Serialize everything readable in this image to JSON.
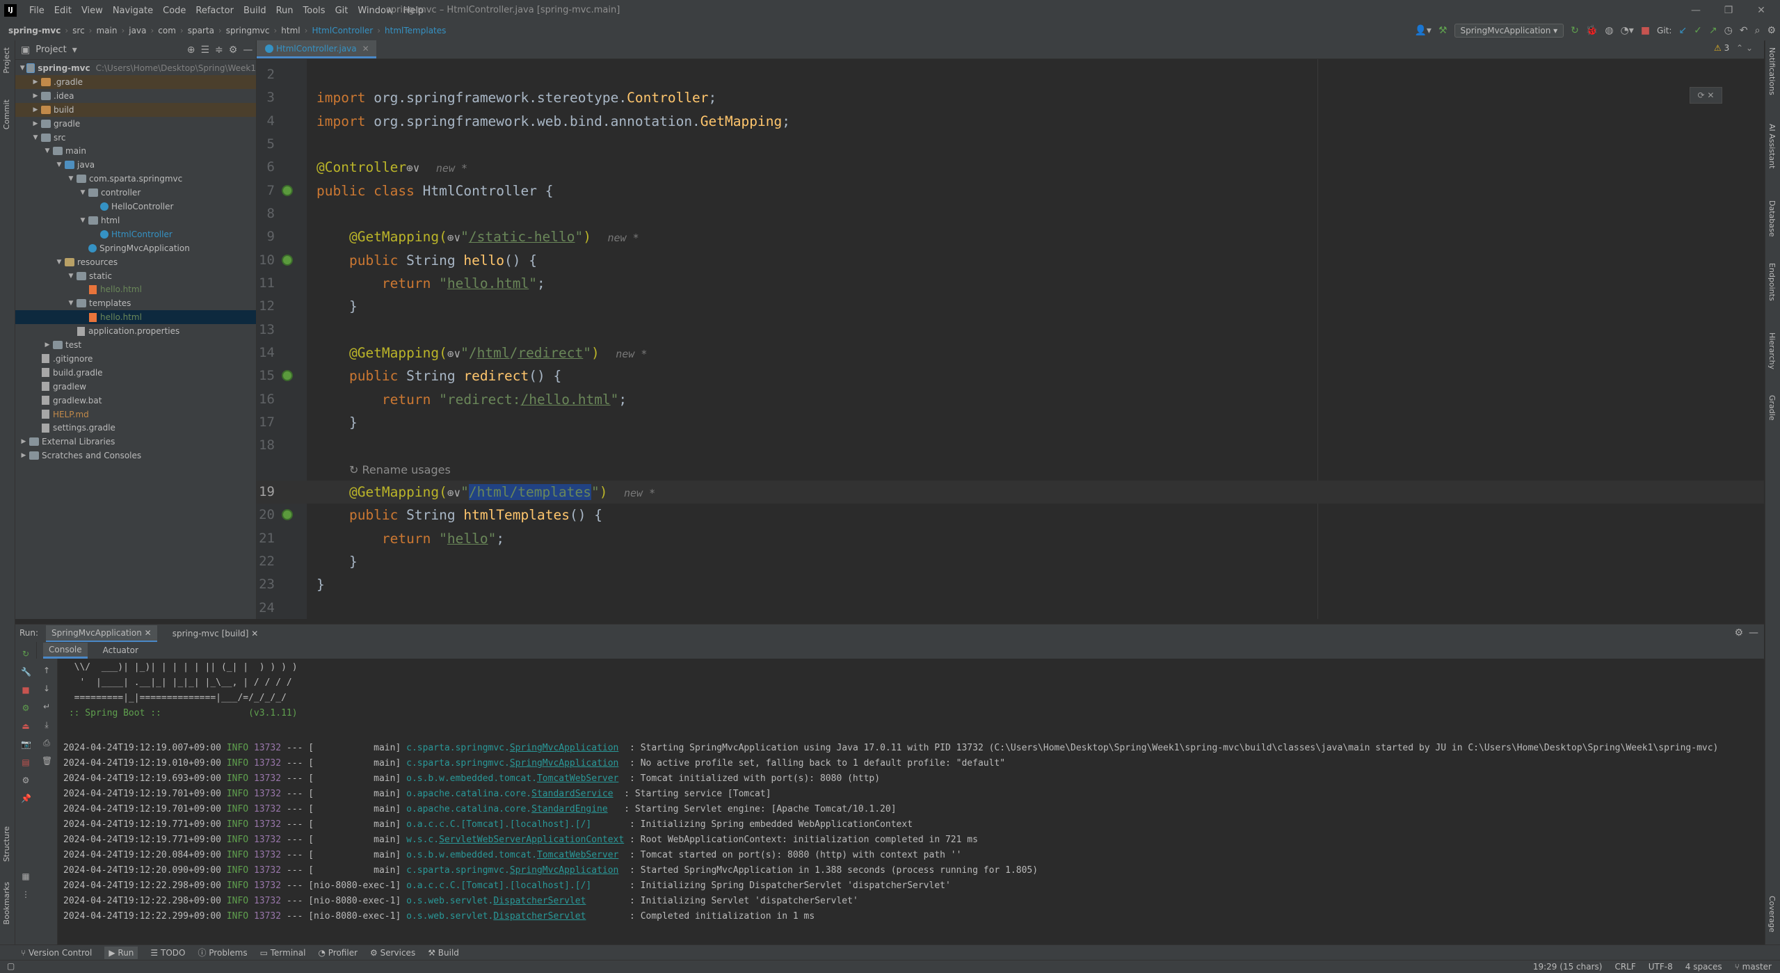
{
  "titlebar": {
    "logo": "IJ",
    "menu": [
      "File",
      "Edit",
      "View",
      "Navigate",
      "Code",
      "Refactor",
      "Build",
      "Run",
      "Tools",
      "Git",
      "Window",
      "Help"
    ],
    "title": "spring-mvc – HtmlController.java [spring-mvc.main]"
  },
  "breadcrumbs": [
    "spring-mvc",
    "src",
    "main",
    "java",
    "com",
    "sparta",
    "springmvc",
    "html",
    "HtmlController",
    "htmlTemplates"
  ],
  "toolbar": {
    "run_config": "SpringMvcApplication",
    "git_label": "Git:"
  },
  "left_stripe": {
    "project": "Project",
    "commit": "Commit",
    "structure": "Structure",
    "bookmarks": "Bookmarks"
  },
  "right_stripe": [
    "Notifications",
    "AI Assistant",
    "Database",
    "Endpoints",
    "Hierarchy",
    "Gradle",
    "Coverage"
  ],
  "project_panel": {
    "title": "Project",
    "tree": [
      {
        "label": "spring-mvc",
        "path": "C:\\Users\\Home\\Desktop\\Spring\\Week1",
        "depth": 0,
        "icon": "module-folder",
        "open": true
      },
      {
        "label": ".gradle",
        "depth": 1,
        "icon": "orange-folder",
        "open": false,
        "hl": true
      },
      {
        "label": ".idea",
        "depth": 1,
        "icon": "folder",
        "open": false
      },
      {
        "label": "build",
        "depth": 1,
        "icon": "orange-folder",
        "open": false,
        "hl": true
      },
      {
        "label": "gradle",
        "depth": 1,
        "icon": "folder",
        "open": false
      },
      {
        "label": "src",
        "depth": 1,
        "icon": "folder",
        "open": true
      },
      {
        "label": "main",
        "depth": 2,
        "icon": "folder",
        "open": true
      },
      {
        "label": "java",
        "depth": 3,
        "icon": "src-folder",
        "open": true
      },
      {
        "label": "com.sparta.springmvc",
        "depth": 4,
        "icon": "folder",
        "open": true
      },
      {
        "label": "controller",
        "depth": 5,
        "icon": "folder",
        "open": true
      },
      {
        "label": "HelloController",
        "depth": 6,
        "icon": "class"
      },
      {
        "label": "html",
        "depth": 5,
        "icon": "folder",
        "open": true
      },
      {
        "label": "HtmlController",
        "depth": 6,
        "icon": "class",
        "color": "#3592c4"
      },
      {
        "label": "SpringMvcApplication",
        "depth": 5,
        "icon": "class"
      },
      {
        "label": "resources",
        "depth": 3,
        "icon": "res-folder",
        "open": true
      },
      {
        "label": "static",
        "depth": 4,
        "icon": "folder",
        "open": true
      },
      {
        "label": "hello.html",
        "depth": 5,
        "icon": "html-file",
        "color": "#6a8759"
      },
      {
        "label": "templates",
        "depth": 4,
        "icon": "folder",
        "open": true
      },
      {
        "label": "hello.html",
        "depth": 5,
        "icon": "html-file",
        "color": "#6a8759",
        "selected": true
      },
      {
        "label": "application.properties",
        "depth": 4,
        "icon": "file"
      },
      {
        "label": "test",
        "depth": 2,
        "icon": "folder",
        "open": false
      },
      {
        "label": ".gitignore",
        "depth": 1,
        "icon": "file"
      },
      {
        "label": "build.gradle",
        "depth": 1,
        "icon": "file"
      },
      {
        "label": "gradlew",
        "depth": 1,
        "icon": "file"
      },
      {
        "label": "gradlew.bat",
        "depth": 1,
        "icon": "file"
      },
      {
        "label": "HELP.md",
        "depth": 1,
        "icon": "file",
        "color": "#c28a4a"
      },
      {
        "label": "settings.gradle",
        "depth": 1,
        "icon": "file"
      },
      {
        "label": "External Libraries",
        "depth": 0,
        "icon": "folder",
        "open": false
      },
      {
        "label": "Scratches and Consoles",
        "depth": 0,
        "icon": "folder",
        "open": false
      }
    ]
  },
  "editor": {
    "tab": "HtmlController.java",
    "warnings": "3",
    "lines": [
      {
        "n": "2",
        "html": ""
      },
      {
        "n": "3",
        "html": "<span class='kw'>import</span> org.springframework.stereotype.<span class='fn'>Controller</span>;"
      },
      {
        "n": "4",
        "html": "<span class='kw'>import</span> org.springframework.web.bind.annotation.<span class='fn'>GetMapping</span>;"
      },
      {
        "n": "5",
        "html": ""
      },
      {
        "n": "6",
        "html": "<span class='ann'>@Controller</span><span class='globe'>⊕∨</span>  <span class='hint'>new *</span>"
      },
      {
        "n": "7",
        "html": "<span class='kw'>public class</span> HtmlController {",
        "bean": true
      },
      {
        "n": "8",
        "html": ""
      },
      {
        "n": "9",
        "html": "    <span class='ann'>@GetMapping(</span><span class='globe'>⊕∨</span><span class='str'>\"</span><span class='strul'>/static-hello</span><span class='str'>\"</span><span class='ann'>)</span>  <span class='hint'>new *</span>"
      },
      {
        "n": "10",
        "html": "    <span class='kw'>public</span> String <span class='fn'>hello</span>() {",
        "bean": true
      },
      {
        "n": "11",
        "html": "        <span class='kw'>return</span> <span class='str'>\"</span><span class='strul'>hello.html</span><span class='str'>\"</span>;"
      },
      {
        "n": "12",
        "html": "    }"
      },
      {
        "n": "13",
        "html": ""
      },
      {
        "n": "14",
        "html": "    <span class='ann'>@GetMapping(</span><span class='globe'>⊕∨</span><span class='str'>\"/</span><span class='strul'>html</span><span class='str'>/</span><span class='strul'>redirect</span><span class='str'>\"</span><span class='ann'>)</span>  <span class='hint'>new *</span>"
      },
      {
        "n": "15",
        "html": "    <span class='kw'>public</span> String <span class='fn'>redirect</span>() {",
        "bean": true
      },
      {
        "n": "16",
        "html": "        <span class='kw'>return</span> <span class='str'>\"redirect:</span><span class='strul'>/hello.html</span><span class='str'>\"</span>;"
      },
      {
        "n": "17",
        "html": "    }"
      },
      {
        "n": "18",
        "html": ""
      },
      {
        "n": "",
        "html": "    <span style='color:#8c8c8c;font-size:16px;font-family:DejaVu Sans,sans-serif'>↻ Rename usages</span>"
      },
      {
        "n": "19",
        "html": "    <span class='ann'>@GetMapping(</span><span class='globe'>⊕∨</span><span class='str'>\"</span><span class='sel-text'>/html/templates</span><span class='str'>\"</span><span class='ann'>)</span>  <span class='hint'>new *</span>",
        "cur": true
      },
      {
        "n": "20",
        "html": "    <span class='kw'>public</span> String <span class='fn'>htmlTemplates</span>() {",
        "bean": true
      },
      {
        "n": "21",
        "html": "        <span class='kw'>return</span> <span class='str'>\"</span><span class='strul'>hello</span><span class='str'>\"</span>;"
      },
      {
        "n": "22",
        "html": "    }"
      },
      {
        "n": "23",
        "html": "}"
      },
      {
        "n": "24",
        "html": ""
      }
    ]
  },
  "run_panel": {
    "label": "Run:",
    "tabs": [
      "SpringMvcApplication",
      "spring-mvc [build]"
    ],
    "subtabs": [
      "Console",
      "Actuator"
    ],
    "banner": [
      "  \\\\/  ___)| |_)| | | | | || (_| |  ) ) ) )",
      "   '  |____| .__|_| |_|_| |_\\__, | / / / /",
      "  =========|_|==============|___/=/_/_/_/",
      " :: Spring Boot ::                (v3.1.11)"
    ],
    "logs": [
      {
        "ts": "2024-04-24T19:12:19.007+09:00",
        "level": "INFO",
        "pid": "13732",
        "thread": "[           main]",
        "logger_pre": "c.sparta.springmvc.",
        "logger_ul": "SpringMvcApplication",
        "logger_post": "  ",
        "msg": ": Starting SpringMvcApplication using Java 17.0.11 with PID 13732 (C:\\Users\\Home\\Desktop\\Spring\\Week1\\spring-mvc\\build\\classes\\java\\main started by JU in C:\\Users\\Home\\Desktop\\Spring\\Week1\\spring-mvc)"
      },
      {
        "ts": "2024-04-24T19:12:19.010+09:00",
        "level": "INFO",
        "pid": "13732",
        "thread": "[           main]",
        "logger_pre": "c.sparta.springmvc.",
        "logger_ul": "SpringMvcApplication",
        "logger_post": "  ",
        "msg": ": No active profile set, falling back to 1 default profile: \"default\""
      },
      {
        "ts": "2024-04-24T19:12:19.693+09:00",
        "level": "INFO",
        "pid": "13732",
        "thread": "[           main]",
        "logger_pre": "o.s.b.w.embedded.tomcat.",
        "logger_ul": "TomcatWebServer",
        "logger_post": "  ",
        "msg": ": Tomcat initialized with port(s): 8080 (http)"
      },
      {
        "ts": "2024-04-24T19:12:19.701+09:00",
        "level": "INFO",
        "pid": "13732",
        "thread": "[           main]",
        "logger_pre": "o.apache.catalina.core.",
        "logger_ul": "StandardService",
        "logger_post": "  ",
        "msg": ": Starting service [Tomcat]"
      },
      {
        "ts": "2024-04-24T19:12:19.701+09:00",
        "level": "INFO",
        "pid": "13732",
        "thread": "[           main]",
        "logger_pre": "o.apache.catalina.core.",
        "logger_ul": "StandardEngine",
        "logger_post": "   ",
        "msg": ": Starting Servlet engine: [Apache Tomcat/10.1.20]"
      },
      {
        "ts": "2024-04-24T19:12:19.771+09:00",
        "level": "INFO",
        "pid": "13732",
        "thread": "[           main]",
        "logger_pre": "o.a.c.c.C.[Tomcat].[localhost].[/]",
        "logger_ul": "",
        "logger_post": "       ",
        "msg": ": Initializing Spring embedded WebApplicationContext"
      },
      {
        "ts": "2024-04-24T19:12:19.771+09:00",
        "level": "INFO",
        "pid": "13732",
        "thread": "[           main]",
        "logger_pre": "w.s.c.",
        "logger_ul": "ServletWebServerApplicationContext",
        "logger_post": " ",
        "msg": ": Root WebApplicationContext: initialization completed in 721 ms"
      },
      {
        "ts": "2024-04-24T19:12:20.084+09:00",
        "level": "INFO",
        "pid": "13732",
        "thread": "[           main]",
        "logger_pre": "o.s.b.w.embedded.tomcat.",
        "logger_ul": "TomcatWebServer",
        "logger_post": "  ",
        "msg": ": Tomcat started on port(s): 8080 (http) with context path ''"
      },
      {
        "ts": "2024-04-24T19:12:20.090+09:00",
        "level": "INFO",
        "pid": "13732",
        "thread": "[           main]",
        "logger_pre": "c.sparta.springmvc.",
        "logger_ul": "SpringMvcApplication",
        "logger_post": "  ",
        "msg": ": Started SpringMvcApplication in 1.388 seconds (process running for 1.805)"
      },
      {
        "ts": "2024-04-24T19:12:22.298+09:00",
        "level": "INFO",
        "pid": "13732",
        "thread": "[nio-8080-exec-1]",
        "logger_pre": "o.a.c.c.C.[Tomcat].[localhost].[/]",
        "logger_ul": "",
        "logger_post": "       ",
        "msg": ": Initializing Spring DispatcherServlet 'dispatcherServlet'"
      },
      {
        "ts": "2024-04-24T19:12:22.298+09:00",
        "level": "INFO",
        "pid": "13732",
        "thread": "[nio-8080-exec-1]",
        "logger_pre": "o.s.web.servlet.",
        "logger_ul": "DispatcherServlet",
        "logger_post": "        ",
        "msg": ": Initializing Servlet 'dispatcherServlet'"
      },
      {
        "ts": "2024-04-24T19:12:22.299+09:00",
        "level": "INFO",
        "pid": "13732",
        "thread": "[nio-8080-exec-1]",
        "logger_pre": "o.s.web.servlet.",
        "logger_ul": "DispatcherServlet",
        "logger_post": "        ",
        "msg": ": Completed initialization in 1 ms"
      }
    ]
  },
  "bottom_tools": [
    "Version Control",
    "Run",
    "TODO",
    "Problems",
    "Terminal",
    "Profiler",
    "Services",
    "Build"
  ],
  "statusbar": {
    "position": "19:29 (15 chars)",
    "line_sep": "CRLF",
    "encoding": "UTF-8",
    "indent": "4 spaces",
    "branch": "master"
  }
}
